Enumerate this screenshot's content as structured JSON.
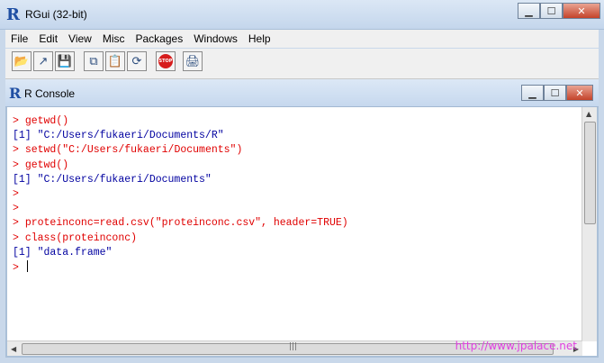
{
  "window": {
    "title": "RGui (32-bit)",
    "logo": "R",
    "min_glyph": "▁",
    "max_glyph": "☐",
    "close_glyph": "✕"
  },
  "menu": [
    "File",
    "Edit",
    "View",
    "Misc",
    "Packages",
    "Windows",
    "Help"
  ],
  "toolbar": [
    {
      "icon": "open-folder-icon",
      "glyph": "📂"
    },
    {
      "icon": "load-workspace-icon",
      "glyph": "↗"
    },
    {
      "icon": "save-icon",
      "glyph": "💾"
    },
    {
      "icon": "copy-icon",
      "glyph": "⧉"
    },
    {
      "icon": "paste-icon",
      "glyph": "📋"
    },
    {
      "icon": "copy-paste-icon",
      "glyph": "⟳"
    },
    {
      "icon": "stop-icon",
      "glyph": "STOP"
    },
    {
      "icon": "print-icon",
      "glyph": "🖨"
    }
  ],
  "console": {
    "title": "R Console",
    "logo": "R",
    "lines": [
      {
        "prompt": "> ",
        "text": "getwd()",
        "type": "cmd"
      },
      {
        "prompt": "",
        "text": "[1] \"C:/Users/fukaeri/Documents/R\"",
        "type": "out"
      },
      {
        "prompt": "> ",
        "text": "setwd(\"C:/Users/fukaeri/Documents\")",
        "type": "cmd"
      },
      {
        "prompt": "> ",
        "text": "getwd()",
        "type": "cmd"
      },
      {
        "prompt": "",
        "text": "[1] \"C:/Users/fukaeri/Documents\"",
        "type": "out"
      },
      {
        "prompt": ">",
        "text": "",
        "type": "cmd"
      },
      {
        "prompt": ">",
        "text": "",
        "type": "cmd"
      },
      {
        "prompt": "> ",
        "text": "proteinconc=read.csv(\"proteinconc.csv\", header=TRUE)",
        "type": "cmd"
      },
      {
        "prompt": "> ",
        "text": "class(proteinconc)",
        "type": "cmd"
      },
      {
        "prompt": "",
        "text": "[1] \"data.frame\"",
        "type": "out"
      },
      {
        "prompt": "> ",
        "text": "",
        "type": "cmd",
        "cursor": true
      }
    ]
  },
  "hscroll_grip": "|||",
  "watermark": "http://www.jpalace.net"
}
